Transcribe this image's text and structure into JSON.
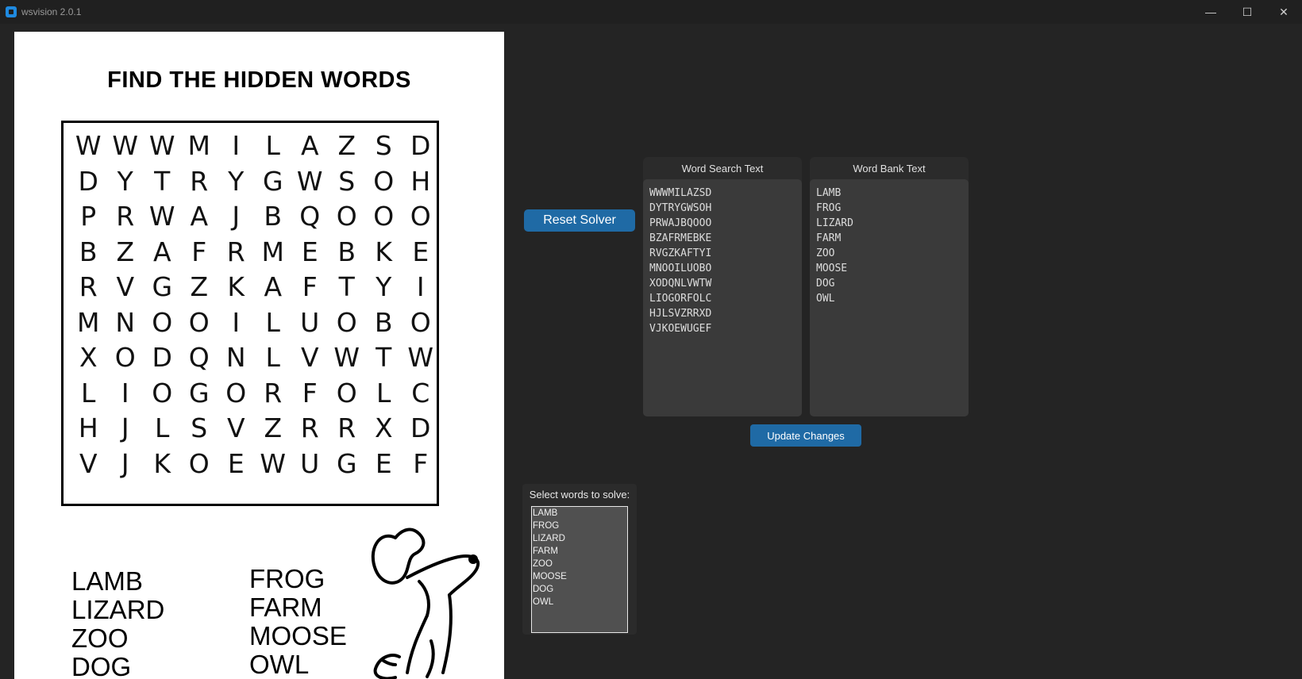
{
  "window": {
    "title": "wsvision 2.0.1",
    "minimize_glyph": "—",
    "maximize_glyph": "☐",
    "close_glyph": "✕"
  },
  "puzzle": {
    "title": "FIND THE HIDDEN WORDS",
    "grid_rows": [
      [
        "W",
        "W",
        "W",
        "M",
        "I",
        "L",
        "A",
        "Z",
        "S",
        "D"
      ],
      [
        "D",
        "Y",
        "T",
        "R",
        "Y",
        "G",
        "W",
        "S",
        "O",
        "H"
      ],
      [
        "P",
        "R",
        "W",
        "A",
        "J",
        "B",
        "Q",
        "O",
        "O",
        "O"
      ],
      [
        "B",
        "Z",
        "A",
        "F",
        "R",
        "M",
        "E",
        "B",
        "K",
        "E"
      ],
      [
        "R",
        "V",
        "G",
        "Z",
        "K",
        "A",
        "F",
        "T",
        "Y",
        "I"
      ],
      [
        "M",
        "N",
        "O",
        "O",
        "I",
        "L",
        "U",
        "O",
        "B",
        "O"
      ],
      [
        "X",
        "O",
        "D",
        "Q",
        "N",
        "L",
        "V",
        "W",
        "T",
        "W"
      ],
      [
        "L",
        "I",
        "O",
        "G",
        "O",
        "R",
        "F",
        "O",
        "L",
        "C"
      ],
      [
        "H",
        "J",
        "L",
        "S",
        "V",
        "Z",
        "R",
        "R",
        "X",
        "D"
      ],
      [
        "V",
        "J",
        "K",
        "O",
        "E",
        "W",
        "U",
        "G",
        "E",
        "F"
      ]
    ],
    "bank_left": [
      "LAMB",
      "LIZARD",
      "ZOO",
      "DOG"
    ],
    "bank_right": [
      "FROG",
      "FARM",
      "MOOSE",
      "OWL"
    ]
  },
  "controls": {
    "reset_label": "Reset Solver",
    "update_label": "Update Changes",
    "word_search_label": "Word Search Text",
    "word_bank_label": "Word Bank Text",
    "select_label": "Select words to solve:"
  },
  "word_search_text": [
    "WWWMILAZSD",
    "DYTRYGWSOH",
    "PRWAJBQOOO",
    "BZAFRMEBKE",
    "RVGZKAFTYI",
    "MNOOILUOBO",
    "XODQNLVWTW",
    "LIOGORFOLC",
    "HJLSVZRRXD",
    "VJKOEWUGEF"
  ],
  "word_bank_text": [
    "LAMB",
    "FROG",
    "LIZARD",
    "FARM",
    "ZOO",
    "MOOSE",
    "DOG",
    "OWL"
  ],
  "select_words": [
    "LAMB",
    "FROG",
    "LIZARD",
    "FARM",
    "ZOO",
    "MOOSE",
    "DOG",
    "OWL"
  ],
  "colors": {
    "accent": "#1f6aa5",
    "background": "#242424",
    "panel": "#2b2b2b"
  }
}
